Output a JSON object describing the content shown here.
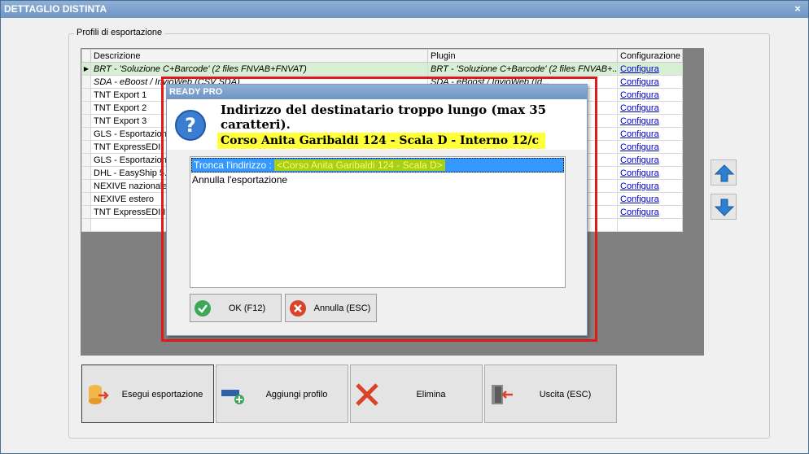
{
  "window": {
    "title": "DETTAGLIO DISTINTA",
    "close": "×"
  },
  "group": {
    "legend": "Profili di esportazione"
  },
  "grid": {
    "columns": [
      "Descrizione",
      "Plugin",
      "Configurazione"
    ],
    "rows": [
      {
        "descr": "BRT - 'Soluzione C+Barcode' (2 files FNVAB+FNVAT)",
        "plugin": "BRT - 'Soluzione C+Barcode' (2 files FNVAB+...",
        "config": "Configura",
        "marker": "▶"
      },
      {
        "descr": "SDA - eBoost / InvioWeb (CSV SDA)",
        "plugin": "SDA - eBoost / InvioWeb (Id...",
        "config": "Configura",
        "marker": ""
      },
      {
        "descr": "TNT Export 1",
        "plugin": "",
        "config": "Configura",
        "marker": ""
      },
      {
        "descr": "TNT Export 2",
        "plugin": "",
        "config": "Configura",
        "marker": ""
      },
      {
        "descr": "TNT Export 3",
        "plugin": "",
        "config": "Configura",
        "marker": ""
      },
      {
        "descr": "GLS - Esportazione",
        "plugin": "",
        "config": "Configura",
        "marker": ""
      },
      {
        "descr": "TNT ExpressEDI",
        "plugin": "",
        "config": "Configura",
        "marker": ""
      },
      {
        "descr": "GLS - Esportazione",
        "plugin": "",
        "config": "Configura",
        "marker": ""
      },
      {
        "descr": "DHL - EasyShip 5.3",
        "plugin": "",
        "config": "Configura",
        "marker": ""
      },
      {
        "descr": "NEXIVE nazionale",
        "plugin": "",
        "config": "Configura",
        "marker": ""
      },
      {
        "descr": "NEXIVE estero",
        "plugin": "",
        "config": "Configura",
        "marker": ""
      },
      {
        "descr": "TNT ExpressEDI II",
        "plugin": "",
        "config": "Configura",
        "marker": ""
      }
    ]
  },
  "buttons": {
    "esegui": "Esegui esportazione",
    "aggiungi": "Aggiungi profilo",
    "elimina": "Elimina",
    "uscita": "Uscita (ESC)"
  },
  "dialog": {
    "title": "READY PRO",
    "message": "Indirizzo del destinatario troppo lungo (max 35 caratteri).",
    "address": "Corso Anita Garibaldi 124 - Scala D - Interno 12/c",
    "options": [
      {
        "label": "Tronca l'indirizzo : ",
        "value": "<Corso Anita Garibaldi 124 - Scala D>"
      },
      {
        "label": "Annulla l'esportazione",
        "value": ""
      }
    ],
    "ok": "OK (F12)",
    "cancel": "Annulla (ESC)"
  },
  "colors": {
    "accent_red": "#e01919",
    "highlight_yellow": "#ffff3a",
    "selected_row": "#d7efd3",
    "link": "#0000cc"
  }
}
